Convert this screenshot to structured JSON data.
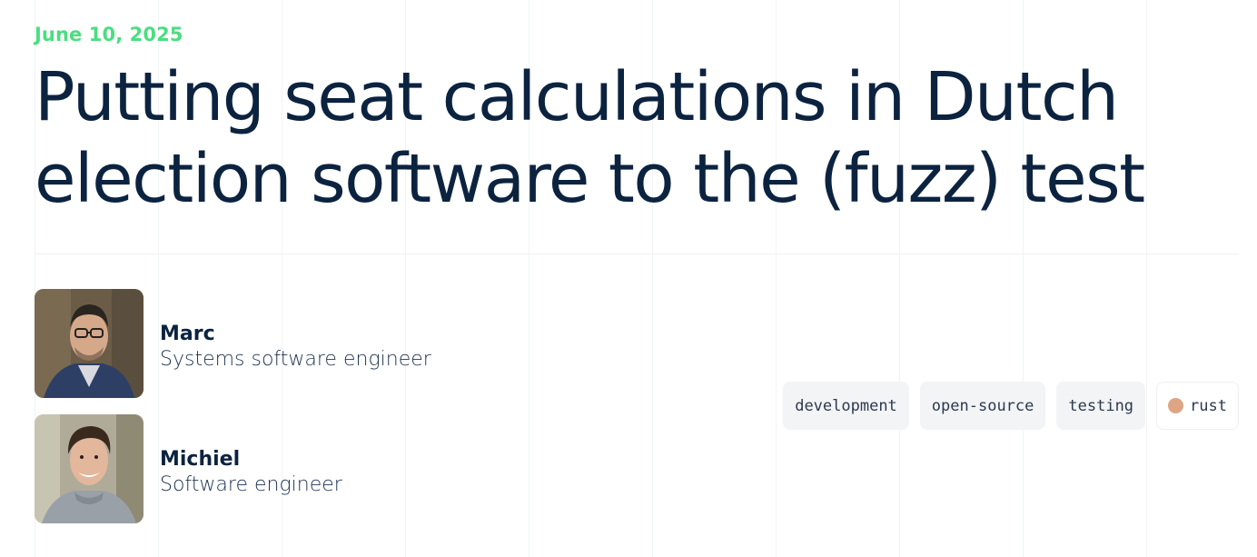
{
  "post": {
    "date": "June 10, 2025",
    "title": "Putting seat calculations in Dutch election software to the (fuzz) test"
  },
  "authors": [
    {
      "name": "Marc",
      "role": "Systems software engineer"
    },
    {
      "name": "Michiel",
      "role": "Software engineer"
    }
  ],
  "tags": [
    {
      "label": "development"
    },
    {
      "label": "open-source"
    },
    {
      "label": "testing"
    },
    {
      "label": "rust",
      "dot_color": "#dea584"
    }
  ],
  "colors": {
    "accent": "#4ade80",
    "title": "#0c2340",
    "tag_bg": "#f3f4f6"
  }
}
